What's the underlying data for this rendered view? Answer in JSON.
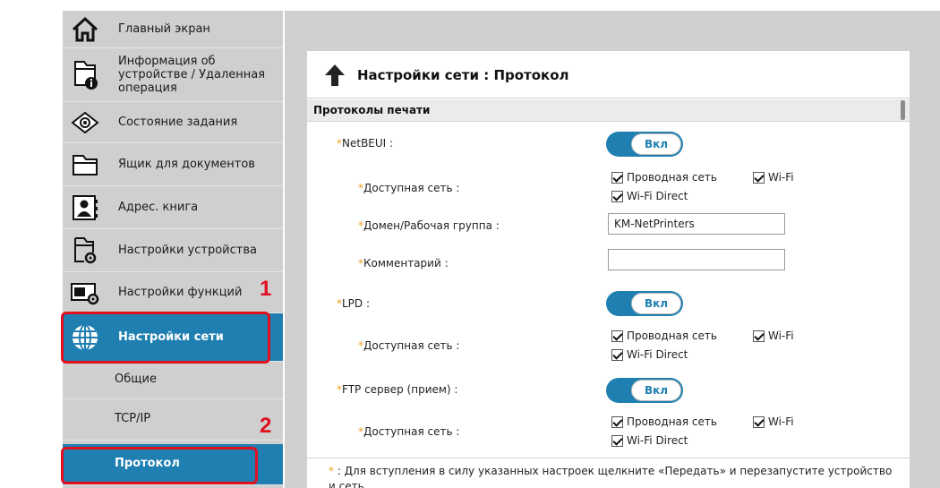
{
  "sidebar": {
    "items": [
      {
        "label": "Главный экран",
        "icon": "home-icon"
      },
      {
        "label": "Информация об устройстве / Удаленная операция",
        "icon": "device-info-icon"
      },
      {
        "label": "Состояние задания",
        "icon": "eye-icon"
      },
      {
        "label": "Ящик для документов",
        "icon": "folder-icon"
      },
      {
        "label": "Адрес. книга",
        "icon": "address-book-icon"
      },
      {
        "label": "Настройки устройства",
        "icon": "device-settings-icon"
      },
      {
        "label": "Настройки функций",
        "icon": "function-settings-icon"
      },
      {
        "label": "Настройки сети",
        "icon": "globe-icon"
      }
    ],
    "subitems": [
      {
        "label": "Общие"
      },
      {
        "label": "TCP/IP"
      },
      {
        "label": "Протокол"
      }
    ]
  },
  "callouts": {
    "one": "1",
    "two": "2"
  },
  "panel": {
    "title": "Настройки сети : Протокол",
    "section": "Протоколы печати"
  },
  "form": {
    "required_mark": "*",
    "netbeui": {
      "label": "NetBEUI :",
      "toggle": "Вкл",
      "network_label": "Доступная сеть :",
      "wired": "Проводная сеть",
      "wifi": "Wi-Fi",
      "wifi_direct": "Wi-Fi Direct",
      "domain_label": "Домен/Рабочая группа :",
      "domain_value": "KM-NetPrinters",
      "comment_label": "Комментарий :",
      "comment_value": ""
    },
    "lpd": {
      "label": "LPD :",
      "toggle": "Вкл",
      "network_label": "Доступная сеть :",
      "wired": "Проводная сеть",
      "wifi": "Wi-Fi",
      "wifi_direct": "Wi-Fi Direct"
    },
    "ftp": {
      "label": "FTP сервер (прием) :",
      "toggle": "Вкл",
      "network_label": "Доступная сеть :",
      "wired": "Проводная сеть",
      "wifi": "Wi-Fi",
      "wifi_direct": "Wi-Fi Direct"
    }
  },
  "footer": {
    "mark": "*",
    "text": ": Для вступления в силу указанных настроек щелкните «Передать» и перезапустите устройство и сеть."
  },
  "colors": {
    "accent": "#1f7fb1",
    "sidebar_bg": "#cfcfcf",
    "highlight": "#e0101f",
    "required": "#f0a020"
  }
}
